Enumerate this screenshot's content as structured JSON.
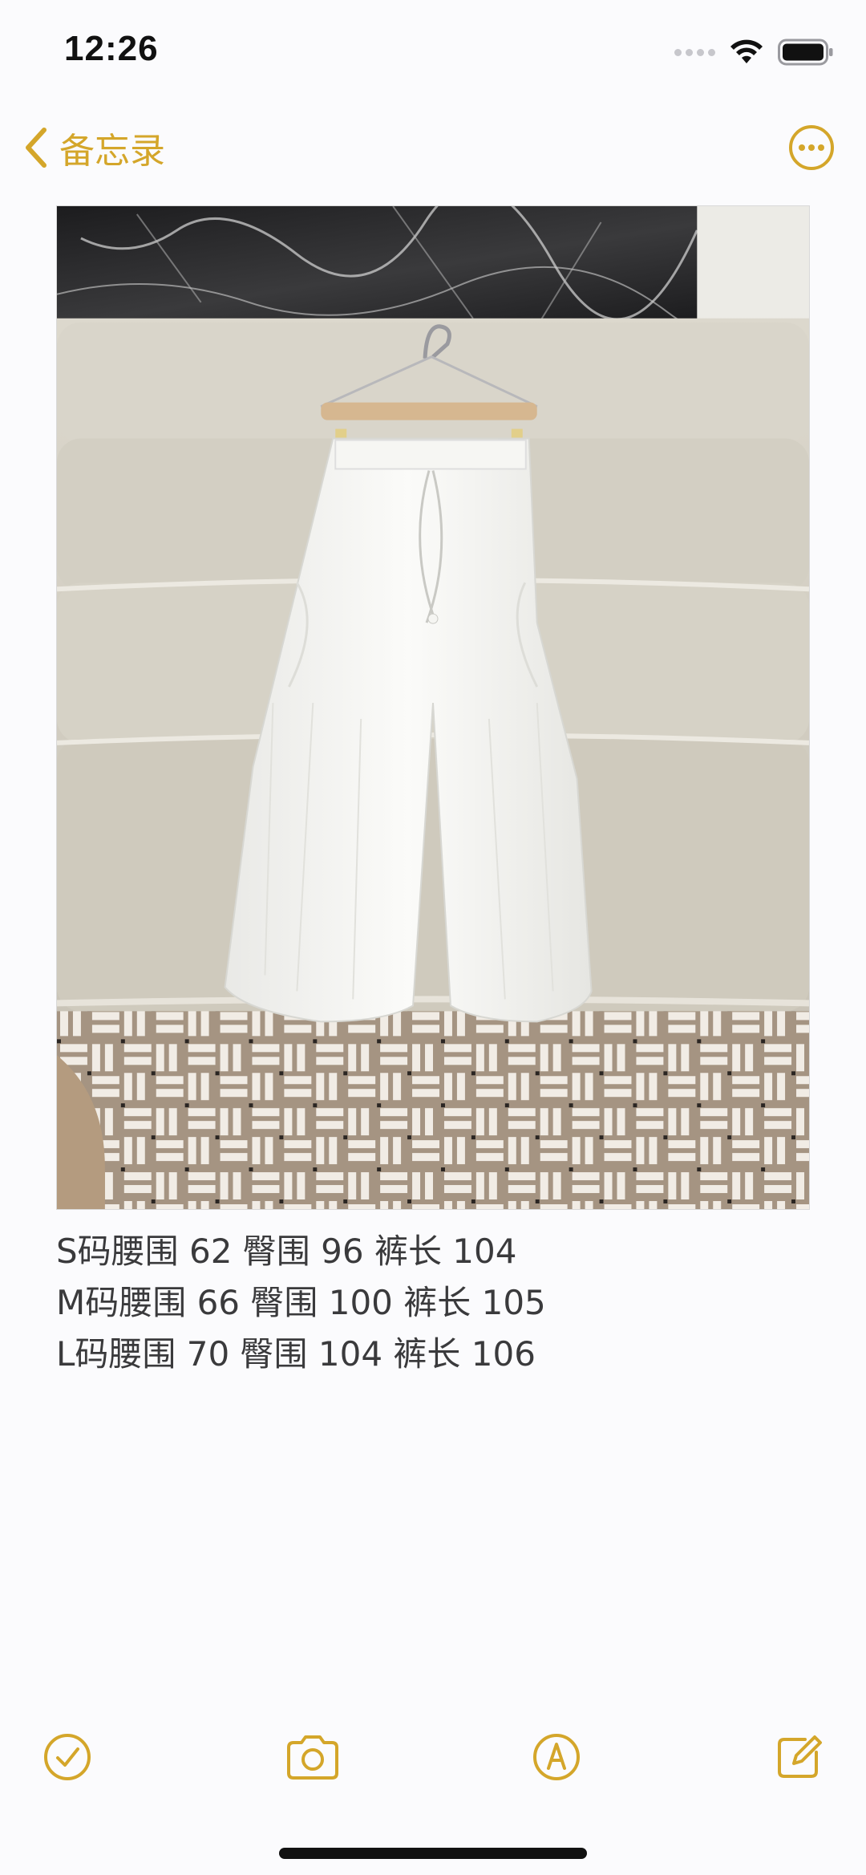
{
  "status_bar": {
    "time": "12:26"
  },
  "nav": {
    "back_label": "备忘录",
    "back_icon": "chevron-left-icon",
    "more_icon": "ellipsis-circle-icon"
  },
  "note": {
    "image": "white wide-leg linen trousers hanging on a wooden hanger over a beige sofa, woven patterned rug below",
    "lines": [
      "S码腰围 62 臀围 96 裤长 104",
      "M码腰围 66 臀围 100 裤长 105",
      "L码腰围 70 臀围 104 裤长 106"
    ]
  },
  "toolbar": {
    "items": [
      "checklist-icon",
      "camera-icon",
      "markup-icon",
      "compose-icon"
    ]
  },
  "colors": {
    "accent": "#d4a62a",
    "background": "#fbfbfd",
    "text": "#3a3a3c"
  }
}
